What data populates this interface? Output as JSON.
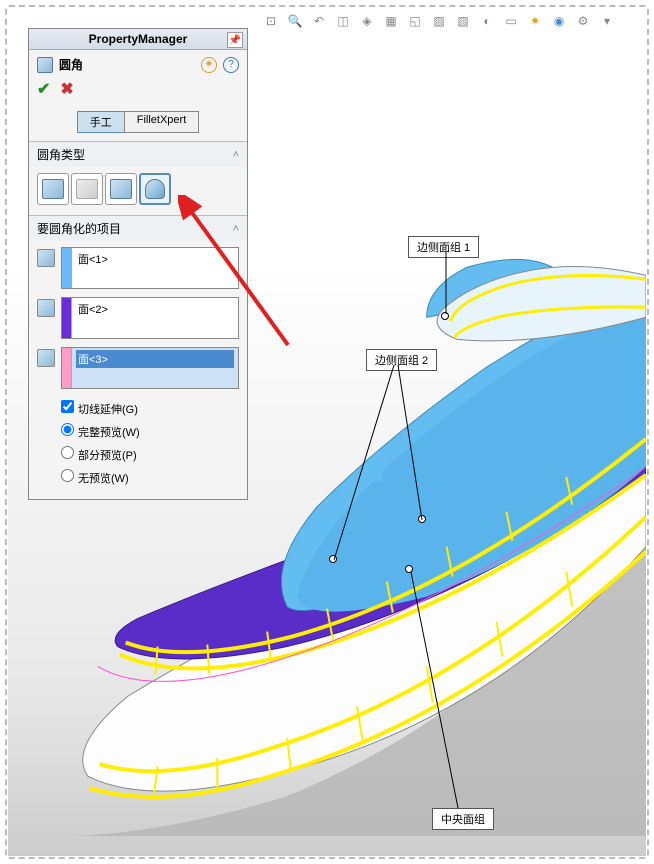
{
  "header": {
    "title": "PropertyManager"
  },
  "feature": {
    "name": "圆角"
  },
  "tabs": {
    "manual": "手工",
    "expert": "FilletXpert"
  },
  "sections": {
    "type": {
      "title": "圆角类型"
    },
    "items": {
      "title": "要圆角化的项目"
    }
  },
  "faces": {
    "f1": "面<1>",
    "f2": "面<2>",
    "f3": "面<3>"
  },
  "options": {
    "tangent": "切线延伸(G)",
    "full_preview": "完整预览(W)",
    "partial_preview": "部分预览(P)",
    "no_preview": "无预览(W)"
  },
  "callouts": {
    "side1": "边侧面组 1",
    "side2": "边侧面组 2",
    "center": "中央面组"
  },
  "colors": {
    "bar1": "#6bb9ff",
    "bar2": "#6a2dd8",
    "bar3": "#ff9bc7",
    "selected": "#4a8acf"
  }
}
